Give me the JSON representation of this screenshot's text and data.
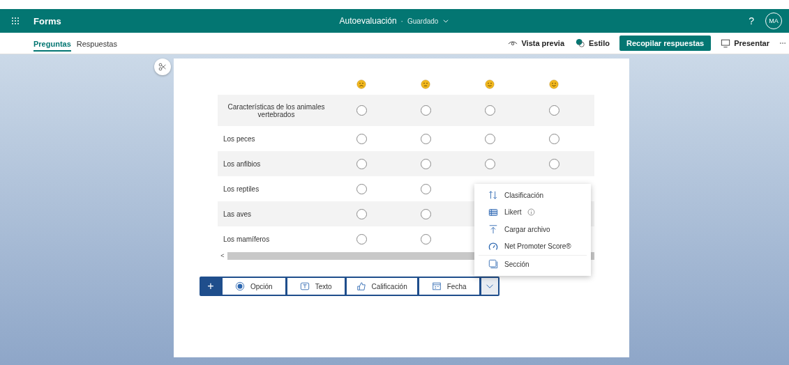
{
  "app_bar": {
    "app_name": "Forms",
    "title": "Autoevaluación",
    "separator": "·",
    "status": "Guardado",
    "help": "?",
    "avatar": "MA"
  },
  "tabs": [
    {
      "label": "Preguntas",
      "selected": true
    },
    {
      "label": "Respuestas",
      "selected": false
    }
  ],
  "actions": [
    {
      "kind": "preview",
      "label": "Vista previa"
    },
    {
      "kind": "style",
      "label": "Estilo"
    },
    {
      "kind": "primary",
      "label": "Recopilar respuestas"
    },
    {
      "kind": "present",
      "label": "Presentar"
    }
  ],
  "likert": {
    "columns": [
      {
        "kind": "frown"
      },
      {
        "kind": "flat"
      },
      {
        "kind": "slight"
      },
      {
        "kind": "smile"
      }
    ],
    "rows": [
      {
        "label": "Características de los animales vertebrados",
        "selected": [
          false,
          false,
          false,
          false
        ]
      },
      {
        "label": "Los peces",
        "selected": [
          false,
          false,
          false,
          false
        ]
      },
      {
        "label": "Los anfibios",
        "selected": [
          false,
          false,
          false,
          false
        ]
      },
      {
        "label": "Los reptiles",
        "selected": [
          false,
          false
        ]
      },
      {
        "label": "Las aves",
        "selected": [
          false,
          false
        ]
      },
      {
        "label": "Los mamíferos",
        "selected": [
          false,
          false
        ]
      }
    ],
    "scroll_left": "<"
  },
  "add_button": "+",
  "question_types": [
    {
      "kind": "choice",
      "label": "Opción"
    },
    {
      "kind": "text",
      "label": "Texto"
    },
    {
      "kind": "rating",
      "label": "Calificación"
    },
    {
      "kind": "date",
      "label": "Fecha"
    }
  ],
  "more_menu": [
    {
      "kind": "ranking",
      "label": "Clasificación",
      "info": false
    },
    {
      "kind": "likert",
      "label": "Likert",
      "info": true
    },
    {
      "kind": "upload",
      "label": "Cargar archivo",
      "info": false
    },
    {
      "kind": "nps",
      "label": "Net Promoter Score®",
      "info": false
    },
    {
      "kind": "section",
      "label": "Sección",
      "info": false
    }
  ]
}
